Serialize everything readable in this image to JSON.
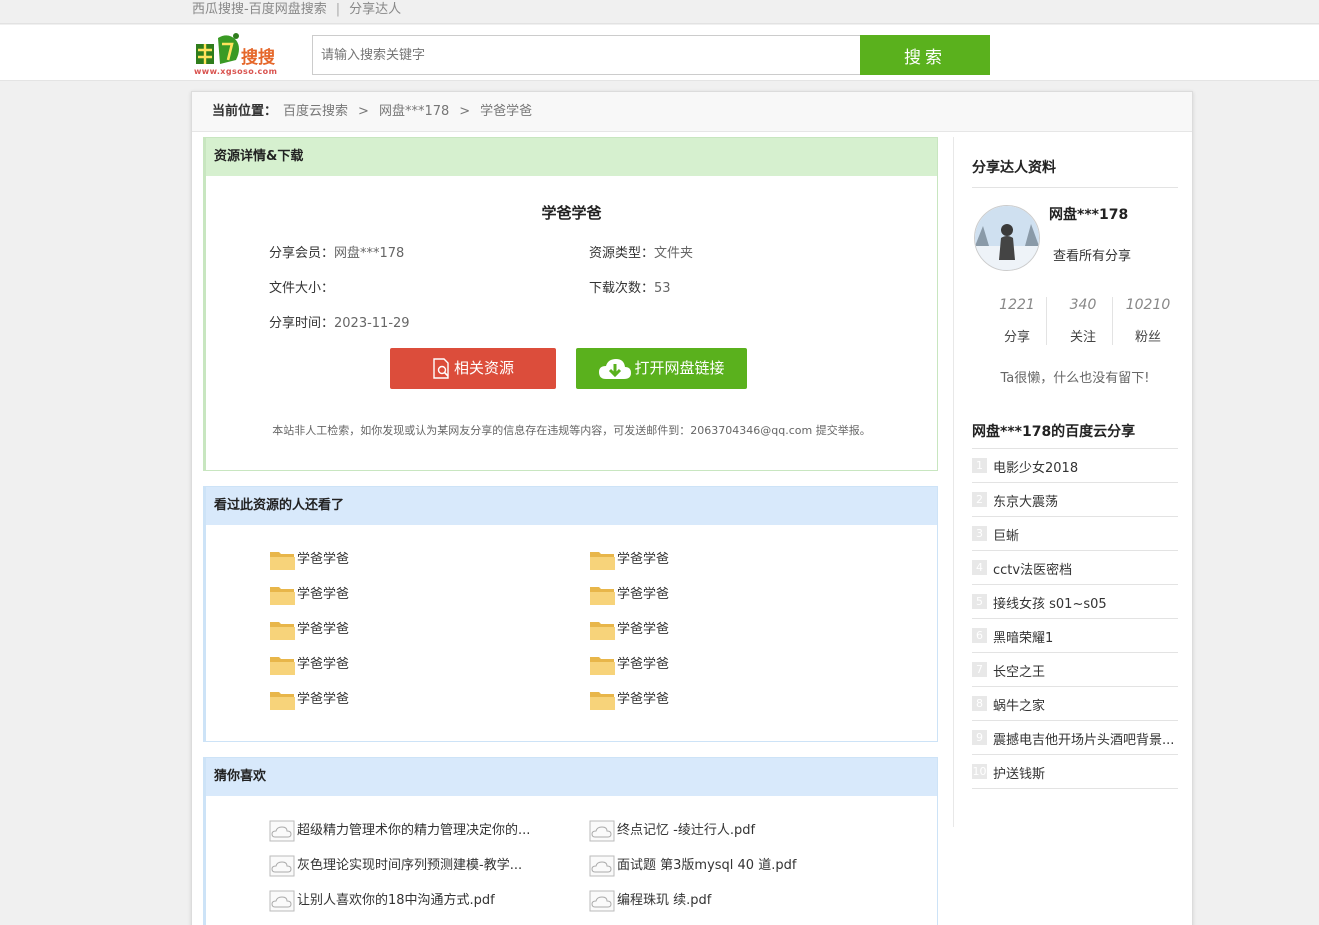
{
  "topbar": {
    "site_name": "西瓜搜搜-百度网盘搜索",
    "separator": "|",
    "link": "分享达人"
  },
  "header": {
    "logo_text": "搜搜",
    "logo_url": "www.xgsoso.com",
    "search_placeholder": "请输入搜索关键字",
    "search_button": "搜索"
  },
  "breadcrumb": {
    "label": "当前位置：",
    "items": [
      "百度云搜索",
      "网盘***178",
      "学爸学爸"
    ],
    "separator": ">"
  },
  "detail": {
    "heading": "资源详情&下载",
    "title": "学爸学爸",
    "fields": [
      {
        "label": "分享会员：",
        "value": "网盘***178"
      },
      {
        "label": "资源类型：",
        "value": "文件夹"
      },
      {
        "label": "文件大小：",
        "value": ""
      },
      {
        "label": "下载次数：",
        "value": "53"
      },
      {
        "label": "分享时间：",
        "value": "2023-11-29"
      }
    ],
    "related_button": "相关资源",
    "open_button": "打开网盘链接",
    "notice": "本站非人工检索，如你发现或认为某网友分享的信息存在违规等内容，可发送邮件到：2063704346@qq.com 提交举报。"
  },
  "also_viewed": {
    "heading": "看过此资源的人还看了",
    "items": [
      "学爸学爸",
      "学爸学爸",
      "学爸学爸",
      "学爸学爸",
      "学爸学爸",
      "学爸学爸",
      "学爸学爸",
      "学爸学爸",
      "学爸学爸",
      "学爸学爸"
    ]
  },
  "guess": {
    "heading": "猜你喜欢",
    "items": [
      "超级精力管理术你的精力管理决定你的...",
      "终点记忆 -绫辻行人.pdf",
      "灰色理论实现时间序列预测建模-教学...",
      "面试题 第3版mysql 40 道.pdf",
      "让别人喜欢你的18中沟通方式.pdf",
      "编程珠玑 续.pdf"
    ]
  },
  "sidebar": {
    "profile_heading": "分享达人资料",
    "username": "网盘***178",
    "view_all": "查看所有分享",
    "stats": [
      {
        "num": "1221",
        "label": "分享"
      },
      {
        "num": "340",
        "label": "关注"
      },
      {
        "num": "10210",
        "label": "粉丝"
      }
    ],
    "bio": "Ta很懒，什么也没有留下!",
    "shares_heading": "网盘***178的百度云分享",
    "shares": [
      {
        "no": "1",
        "title": "电影少女2018"
      },
      {
        "no": "2",
        "title": "东京大震荡"
      },
      {
        "no": "3",
        "title": "巨蜥"
      },
      {
        "no": "4",
        "title": "cctv法医密档"
      },
      {
        "no": "5",
        "title": "接线女孩 s01~s05"
      },
      {
        "no": "6",
        "title": "黑暗荣耀1"
      },
      {
        "no": "7",
        "title": "长空之王"
      },
      {
        "no": "8",
        "title": "蜗牛之家"
      },
      {
        "no": "9",
        "title": "震撼电吉他开场片头酒吧背景..."
      },
      {
        "no": "10",
        "title": "护送钱斯"
      }
    ]
  },
  "colors": {
    "green": "#5ab11d",
    "red": "#dc4d3b",
    "green_panel": "#d6f0cf",
    "blue_panel": "#d8e9fb"
  }
}
